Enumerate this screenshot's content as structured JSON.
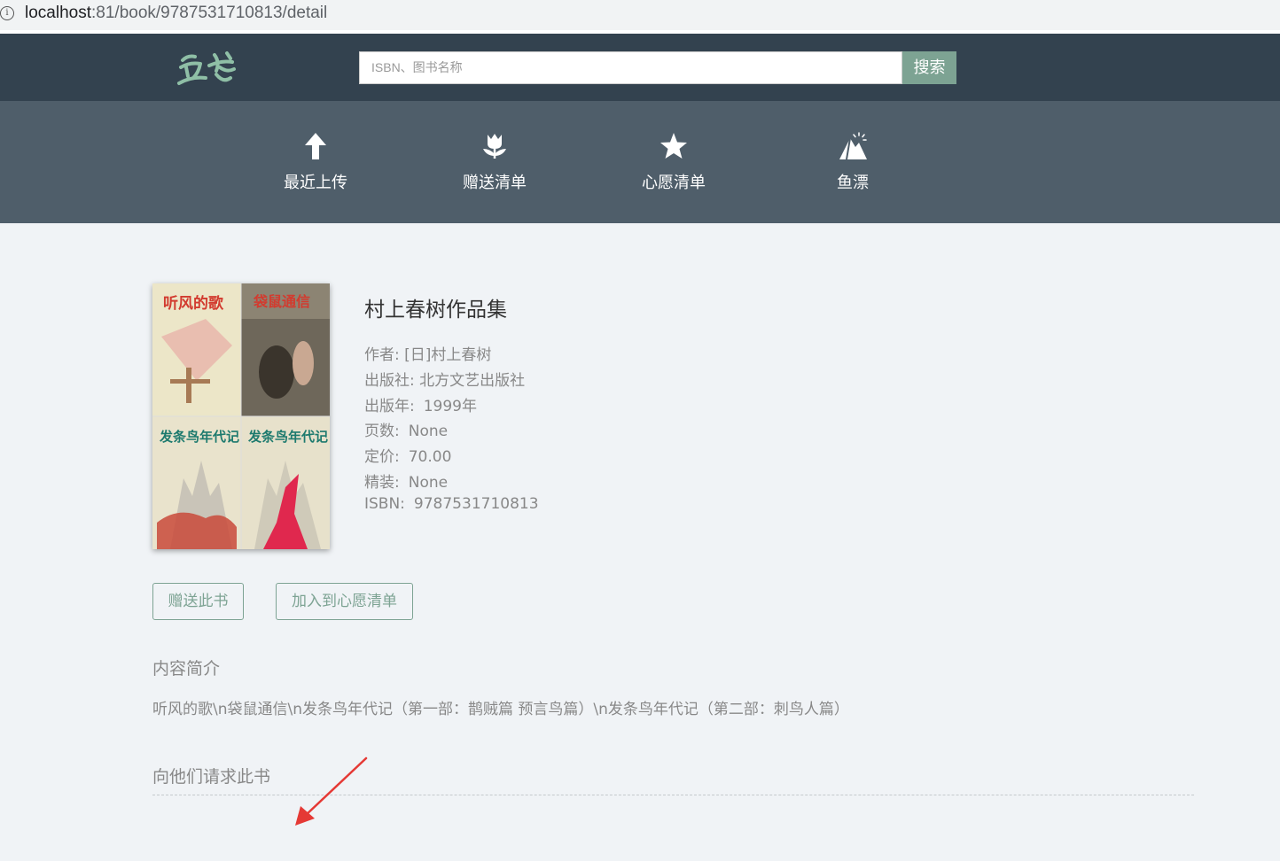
{
  "browser": {
    "url_host": "localhost",
    "url_path": ":81/book/9787531710813/detail",
    "info_icon": "info-icon"
  },
  "header": {
    "logo_text": "鱼书",
    "search_placeholder": "ISBN、图书名称",
    "search_button": "搜索"
  },
  "nav": [
    {
      "label": "最近上传",
      "icon": "arrow-up-icon"
    },
    {
      "label": "赠送清单",
      "icon": "flower-icon"
    },
    {
      "label": "心愿清单",
      "icon": "star-icon"
    },
    {
      "label": "鱼漂",
      "icon": "mountain-icon"
    }
  ],
  "book": {
    "title": "村上春树作品集",
    "author_label": "作者:",
    "author": "[日]村上春树",
    "publisher_label": "出版社:",
    "publisher": "北方文艺出版社",
    "pubdate_label": "出版年:",
    "pubdate": "1999年",
    "pages_label": "页数:",
    "pages": "None",
    "price_label": "定价:",
    "price": "70.00",
    "binding_label": "精装:",
    "binding": "None",
    "isbn_label": "ISBN:",
    "isbn": "9787531710813",
    "cover_titles": [
      "听风的歌",
      "袋鼠通信",
      "发条鸟年代记",
      "发条鸟年代记"
    ]
  },
  "actions": {
    "gift": "赠送此书",
    "wish": "加入到心愿清单"
  },
  "summary": {
    "heading": "内容简介",
    "text": "听风的歌\\n袋鼠通信\\n发条鸟年代记（第一部：鹊贼篇 预言鸟篇）\\n发条鸟年代记（第二部：刺鸟人篇）"
  },
  "request": {
    "heading": "向他们请求此书"
  },
  "colors": {
    "header_bg": "#33424f",
    "nav_bg": "#4f5e6a",
    "accent": "#7da393",
    "page_bg": "#f0f3f6",
    "annotation": "#e53935"
  }
}
